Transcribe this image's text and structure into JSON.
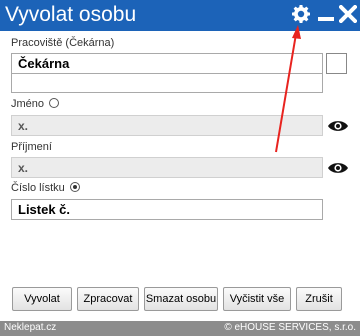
{
  "window": {
    "title": "Vyvolat osobu"
  },
  "titlebar_buttons": {
    "settings_icon": "gear-icon",
    "minimize_icon": "minimize-icon",
    "close_icon": "close-icon"
  },
  "pracoviste": {
    "label": "Pracoviště (Čekárna)",
    "value": "Čekárna",
    "second_line": ""
  },
  "jmeno": {
    "label": "Jméno",
    "value": "x.",
    "selected": false
  },
  "prijmeni": {
    "label": "Příjmení",
    "value": "x."
  },
  "cislo_listku": {
    "label": "Číslo lístku",
    "value": "Listek č.",
    "selected": true
  },
  "buttons": {
    "vyvolat": "Vyvolat",
    "zpracovat": "Zpracovat",
    "smazat_osobu": "Smazat osobu",
    "vycistit_vse": "Vyčistit vše",
    "zrusit": "Zrušit"
  },
  "footer": {
    "left": "Neklepat.cz",
    "right": "© eHOUSE SERVICES, s.r.o."
  },
  "colors": {
    "titlebar": "#1c63b8",
    "footer": "#8c8c8c",
    "annotation_arrow": "#e8231f"
  }
}
